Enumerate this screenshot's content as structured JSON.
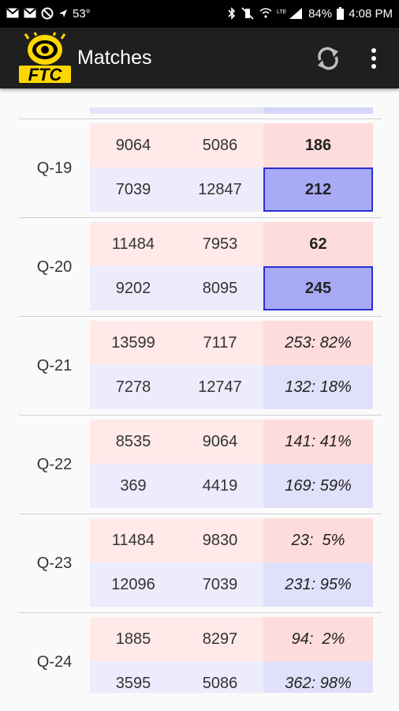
{
  "status_bar": {
    "temperature": "53°",
    "battery": "84%",
    "time": "4:08 PM"
  },
  "app_bar": {
    "logo_text": "FTC",
    "title": "Matches"
  },
  "matches": [
    {
      "label": "Q-19",
      "red": {
        "team1": "9064",
        "team2": "5086",
        "score": "186"
      },
      "blue": {
        "team1": "7039",
        "team2": "12847",
        "score": "212"
      }
    },
    {
      "label": "Q-20",
      "red": {
        "team1": "11484",
        "team2": "7953",
        "score": "62"
      },
      "blue": {
        "team1": "9202",
        "team2": "8095",
        "score": "245"
      }
    },
    {
      "label": "Q-21",
      "red": {
        "team1": "13599",
        "team2": "7117",
        "score": "253: 82%"
      },
      "blue": {
        "team1": "7278",
        "team2": "12747",
        "score": "132: 18%"
      }
    },
    {
      "label": "Q-22",
      "red": {
        "team1": "8535",
        "team2": "9064",
        "score": "141: 41%"
      },
      "blue": {
        "team1": "369",
        "team2": "4419",
        "score": "169: 59%"
      }
    },
    {
      "label": "Q-23",
      "red": {
        "team1": "11484",
        "team2": "9830",
        "score": "23:  5%"
      },
      "blue": {
        "team1": "12096",
        "team2": "7039",
        "score": "231: 95%"
      }
    },
    {
      "label": "Q-24",
      "red": {
        "team1": "1885",
        "team2": "8297",
        "score": "94:  2%"
      },
      "blue": {
        "team1": "3595",
        "team2": "5086",
        "score": "362: 98%"
      }
    }
  ]
}
